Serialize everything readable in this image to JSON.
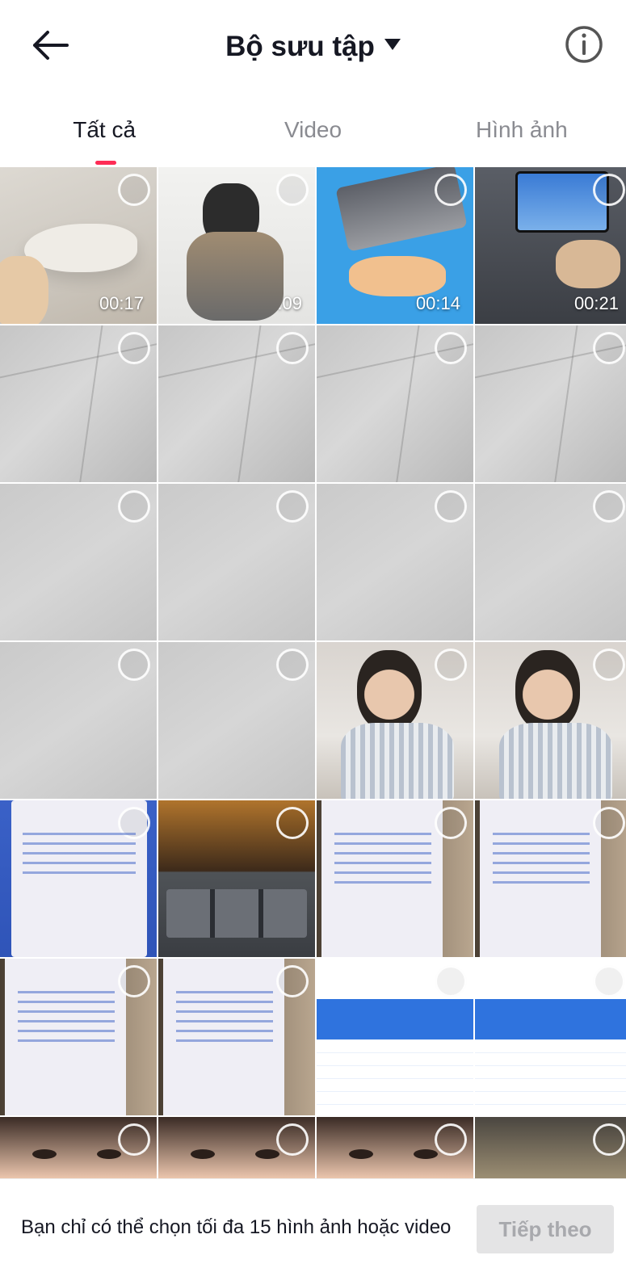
{
  "header": {
    "title": "Bộ sưu tập",
    "back_icon": "arrow-left-icon",
    "dropdown_icon": "caret-down-icon",
    "info_icon": "info-icon"
  },
  "tabs": [
    {
      "label": "Tất cả",
      "active": true
    },
    {
      "label": "Video",
      "active": false
    },
    {
      "label": "Hình ảnh",
      "active": false
    }
  ],
  "accent_color": "#fe2c55",
  "gallery": [
    {
      "thumb": "chair",
      "duration": "00:17"
    },
    {
      "thumb": "gamer",
      "duration": "00:09"
    },
    {
      "thumb": "knife",
      "duration": "00:14"
    },
    {
      "thumb": "phone",
      "duration": "00:21"
    },
    {
      "thumb": "ceiling",
      "duration": ""
    },
    {
      "thumb": "ceiling",
      "duration": ""
    },
    {
      "thumb": "ceiling",
      "duration": ""
    },
    {
      "thumb": "ceiling",
      "duration": ""
    },
    {
      "thumb": "wall",
      "duration": ""
    },
    {
      "thumb": "wall",
      "duration": ""
    },
    {
      "thumb": "wall",
      "duration": ""
    },
    {
      "thumb": "wall",
      "duration": ""
    },
    {
      "thumb": "wall",
      "duration": ""
    },
    {
      "thumb": "wall",
      "duration": ""
    },
    {
      "thumb": "girl",
      "duration": ""
    },
    {
      "thumb": "girl",
      "duration": ""
    },
    {
      "thumb": "bank",
      "duration": ""
    },
    {
      "thumb": "game",
      "duration": ""
    },
    {
      "thumb": "bank2",
      "duration": ""
    },
    {
      "thumb": "bank2",
      "duration": ""
    },
    {
      "thumb": "bank2",
      "duration": ""
    },
    {
      "thumb": "bank2",
      "duration": ""
    },
    {
      "thumb": "table",
      "duration": ""
    },
    {
      "thumb": "table",
      "duration": ""
    },
    {
      "thumb": "face",
      "duration": ""
    },
    {
      "thumb": "face",
      "duration": ""
    },
    {
      "thumb": "face",
      "duration": ""
    },
    {
      "thumb": "room",
      "duration": ""
    }
  ],
  "footer": {
    "message": "Bạn chỉ có thể chọn tối đa 15 hình ảnh hoặc video",
    "next_label": "Tiếp theo"
  }
}
